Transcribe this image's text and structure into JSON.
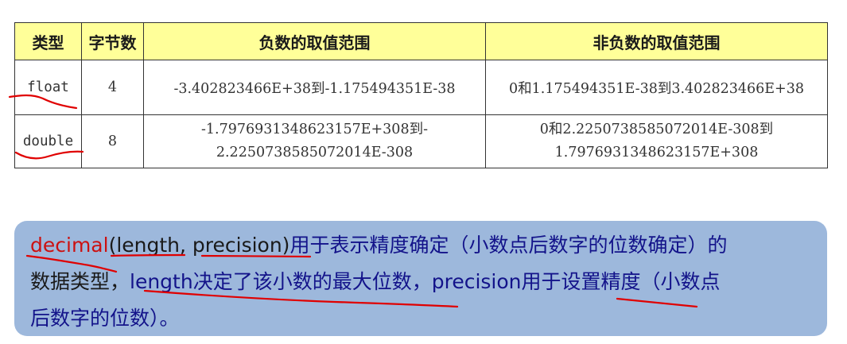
{
  "table": {
    "headers": [
      "类型",
      "字节数",
      "负数的取值范围",
      "非负数的取值范围"
    ],
    "rows": [
      {
        "type": "float",
        "bytes": "4",
        "negative_range": [
          "-3.402823466E+38到-1.175494351E-38"
        ],
        "non_negative_range": [
          "0和1.175494351E-38到3.402823466E+38"
        ]
      },
      {
        "type": "double",
        "bytes": "8",
        "negative_range": [
          "-1.7976931348623157E+308到-",
          "2.2250738585072014E-308"
        ],
        "non_negative_range": [
          "0和2.2250738585072014E-308到",
          "1.7976931348623157E+308"
        ]
      }
    ],
    "header_color": "#FFFF99",
    "border_color": "#333333"
  },
  "note": {
    "decimal": "decimal",
    "params": "(length, precision)",
    "text1": "用于表示精度确定（小数点后数字的位数确定）的",
    "text2": "数据类型，",
    "length_word": "length",
    "text3": "决定了该小数的最大位数，",
    "precision_word": "precision",
    "text4": "用于设置精度（小数点",
    "text5": "后数字的位数）。",
    "background_color": "#9DB8DC",
    "red_color": "#CC1111",
    "blue_color": "#13138A"
  },
  "annotation_color": "#E00000"
}
